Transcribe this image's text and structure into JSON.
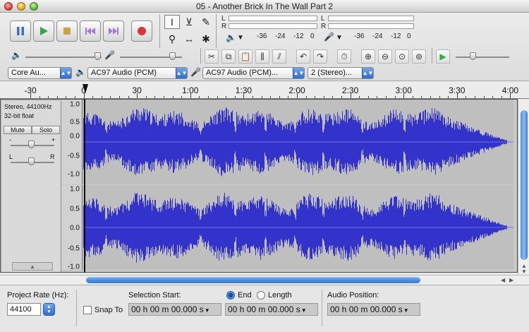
{
  "window": {
    "title": "05 - Another Brick In The Wall Part 2"
  },
  "transport": {
    "buttons": [
      {
        "name": "pause-button",
        "icon": "pause-icon"
      },
      {
        "name": "play-button",
        "icon": "play-icon"
      },
      {
        "name": "stop-button",
        "icon": "stop-icon"
      },
      {
        "name": "skip-to-start-button",
        "icon": "skip-start-icon"
      },
      {
        "name": "skip-to-end-button",
        "icon": "skip-end-icon"
      },
      {
        "name": "record-button",
        "icon": "record-icon"
      }
    ]
  },
  "tools": [
    {
      "name": "selection-tool",
      "glyph": "I",
      "active": true
    },
    {
      "name": "envelope-tool",
      "glyph": "⊻",
      "active": false
    },
    {
      "name": "draw-tool",
      "glyph": "✎",
      "active": false
    },
    {
      "name": "zoom-tool",
      "glyph": "⚲",
      "active": false
    },
    {
      "name": "timeshift-tool",
      "glyph": "↔",
      "active": false
    },
    {
      "name": "multi-tool",
      "glyph": "✱",
      "active": false
    }
  ],
  "meters": {
    "left_label": "L",
    "right_label": "R",
    "play_scale": [
      "-36",
      "-24",
      "-12",
      "0"
    ],
    "record_scale": [
      "-36",
      "-24",
      "-12",
      "0"
    ]
  },
  "devices": {
    "host": "Core Au...",
    "output": "AC97 Audio (PCM)",
    "input": "AC97 Audio (PCM)...",
    "channels": "2 (Stereo)..."
  },
  "ruler": {
    "labels": [
      "-30",
      "0",
      "30",
      "1:00",
      "1:30",
      "2:00",
      "2:30",
      "3:00",
      "3:30",
      "4:00"
    ]
  },
  "track": {
    "format_line1": "Stereo, 44100Hz",
    "format_line2": "32-bit float",
    "mute_label": "Mute",
    "solo_label": "Solo",
    "gain_minus": "-",
    "gain_plus": "+",
    "pan_left": "L",
    "pan_right": "R",
    "collapse_glyph": "▲",
    "scale_top": [
      "1.0",
      "0.5",
      "0.0",
      "-0.5",
      "-1.0"
    ],
    "scale_bottom": [
      "1.0",
      "0.5",
      "0.0",
      "-0.5",
      "-1.0"
    ],
    "wave_color": "#3333cc"
  },
  "selection_bar": {
    "project_rate_label": "Project Rate (Hz):",
    "project_rate_value": "44100",
    "snap_to_label": "Snap To",
    "selection_start_label": "Selection Start:",
    "end_label": "End",
    "length_label": "Length",
    "audio_position_label": "Audio Position:",
    "selection_start_value": "00 h 00 m 00.000 s",
    "selection_end_value": "00 h 00 m 00.000 s",
    "audio_position_value": "00 h 00 m 00.000 s"
  }
}
